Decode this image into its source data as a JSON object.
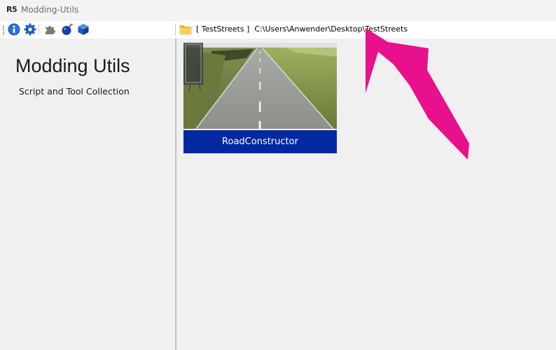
{
  "window": {
    "logo_text": "R5",
    "title": "Modding-Utils"
  },
  "toolbar": {
    "icons": [
      "info-icon",
      "gear-icon",
      "puzzle-icon",
      "bomb-icon",
      "cube-icon"
    ],
    "path": {
      "folder_icon": "folder-icon",
      "text": "[ TestStreets ]  C:\\Users\\Anwender\\Desktop\\TestStreets"
    }
  },
  "sidebar": {
    "title": "Modding Utils",
    "subtitle": "Script and Tool Collection"
  },
  "tools": [
    {
      "label": "RoadConstructor",
      "thumbnail": "road-thumbnail"
    }
  ],
  "colors": {
    "accent": "#0028a0",
    "annotation": "#e8108c",
    "icon_blue": "#1a5fbf"
  }
}
